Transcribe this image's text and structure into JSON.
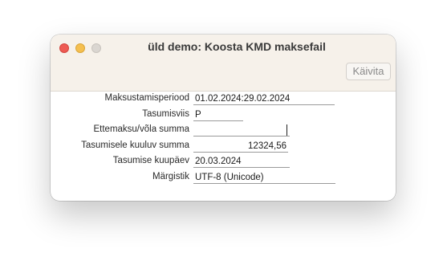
{
  "window": {
    "title": "üld demo: Koosta KMD maksefail",
    "run_button": "Käivita"
  },
  "form": {
    "rows": [
      {
        "label": "Maksustamisperiood",
        "value": "01.02.2024:29.02.2024"
      },
      {
        "label": "Tasumisviis",
        "value": "P"
      },
      {
        "label": "Ettemaksu/võla summa",
        "value": ""
      },
      {
        "label": "Tasumisele kuuluv summa",
        "value": "12324,56"
      },
      {
        "label": "Tasumise kuupäev",
        "value": "20.03.2024"
      },
      {
        "label": "Märgistik",
        "value": "UTF-8 (Unicode)"
      }
    ]
  }
}
